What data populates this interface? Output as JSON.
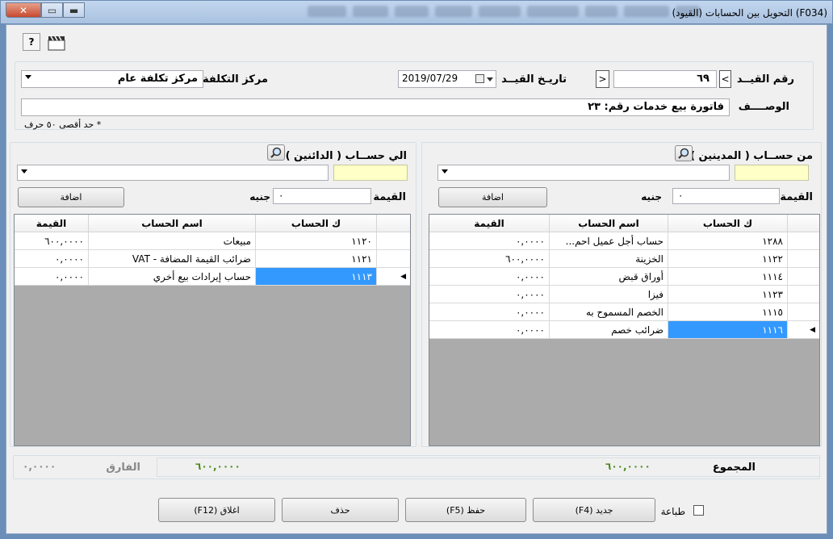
{
  "window": {
    "title": "(F034)  التحويل بين الحسابات (القيود)"
  },
  "toolbar": {
    "help_icon": "help-icon",
    "clapper_icon": "clapper-icon"
  },
  "header": {
    "entry_no_label": "رقم القيــد",
    "entry_no_value": "٦٩",
    "prev_label": "<",
    "next_label": ">",
    "entry_date_label": "تاريـخ القيــد",
    "entry_date_value": "2019/07/29",
    "cost_center_label": "مركز التكلفة",
    "cost_center_value": "مركز تكلفة عام",
    "description_label": "الوصــــف",
    "description_value": "فاتورة بيع خدمات رقم: ٢٣",
    "max_chars_note": "* حد أقصى ٥٠ حرف"
  },
  "from_panel": {
    "title": "من حســاب ( المدينين )",
    "amount_label": "القيمة",
    "amount_value": "٠",
    "currency": "جنيه",
    "add_label": "اضافة",
    "columns": [
      "ك الحساب",
      "اسم الحساب",
      "القيمة"
    ],
    "rows": [
      {
        "code": "١٢٨٨",
        "name": "حساب أجل عميل احم...",
        "value": "٠,٠٠٠٠"
      },
      {
        "code": "١١٢٢",
        "name": "الخزينة",
        "value": "٦٠٠,٠٠٠٠"
      },
      {
        "code": "١١١٤",
        "name": "أوراق قبض",
        "value": "٠,٠٠٠٠"
      },
      {
        "code": "١١٢٣",
        "name": "فيزا",
        "value": "٠,٠٠٠٠"
      },
      {
        "code": "١١١٥",
        "name": "الخصم المسموح به",
        "value": "٠,٠٠٠٠"
      },
      {
        "code": "١١١٦",
        "name": "ضرائب خصم",
        "value": "٠,٠٠٠٠"
      }
    ],
    "total_label": "المجموع",
    "total_value": "٦٠٠,٠٠٠٠"
  },
  "to_panel": {
    "title": "الي حســاب ( الدائنين )",
    "amount_label": "القيمة",
    "amount_value": "٠",
    "currency": "جنيه",
    "add_label": "اضافة",
    "columns": [
      "ك الحساب",
      "اسم الحساب",
      "القيمة"
    ],
    "rows": [
      {
        "code": "١١٢٠",
        "name": "مبيعات",
        "value": "٦٠٠,٠٠٠٠"
      },
      {
        "code": "١١٢١",
        "name": "ضرائب القيمة المضافة - VAT",
        "value": "٠,٠٠٠٠"
      },
      {
        "code": "١١١٣",
        "name": "حساب إيرادات بيع أخري",
        "value": "٠,٠٠٠٠"
      }
    ],
    "total_value": "٦٠٠,٠٠٠٠",
    "diff_label": "الفارق",
    "diff_value": "٠,٠٠٠٠"
  },
  "footer": {
    "print_label": "طباعة",
    "new_label": "جديد (F4)",
    "save_label": "حفظ (F5)",
    "delete_label": "حذف",
    "close_label": "اغلاق (F12)"
  },
  "colors": {
    "selection": "#3399ff",
    "total_green": "#4a8a1a",
    "grid_bg": "#ababab",
    "input_yellow": "#ffffc8"
  }
}
